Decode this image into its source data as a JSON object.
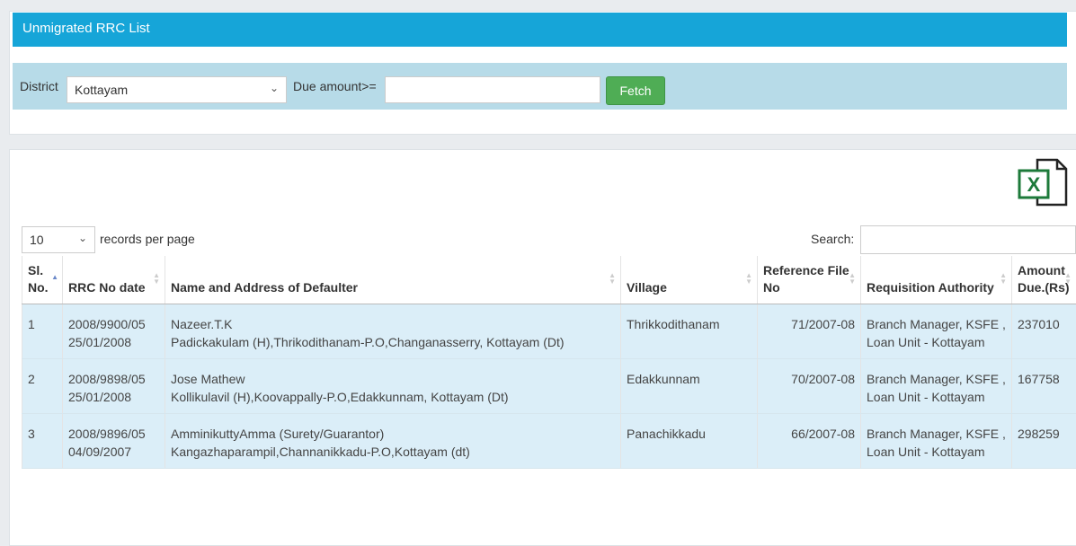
{
  "header": {
    "title": "Unmigrated RRC List"
  },
  "filters": {
    "district_label": "District",
    "district_value": "Kottayam",
    "due_label": "Due amount>=",
    "due_value": "",
    "fetch_label": "Fetch"
  },
  "export": {
    "icon": "excel-icon",
    "letter": "X"
  },
  "controls": {
    "page_length": "10",
    "page_length_suffix": "records per page",
    "search_label": "Search:",
    "search_value": ""
  },
  "table": {
    "headers": [
      "Sl. No.",
      "RRC No date",
      "Name and Address of Defaulter",
      "Village",
      "Reference File No",
      "Requisition Authority",
      "Amount Due.(Rs)"
    ],
    "rows": [
      {
        "sl": "1",
        "rrc_no": "2008/9900/05",
        "rrc_date": "25/01/2008",
        "name": "Nazeer.T.K",
        "address": "Padickakulam (H),Thrikodithanam-P.O,Changanasserry, Kottayam (Dt)",
        "village": "Thrikkodithanam",
        "ref": "71/2007-08",
        "authority": "Branch Manager, KSFE , Loan Unit - Kottayam",
        "amount": "237010"
      },
      {
        "sl": "2",
        "rrc_no": "2008/9898/05",
        "rrc_date": "25/01/2008",
        "name": "Jose Mathew",
        "address": "Kollikulavil (H),Koovappally-P.O,Edakkunnam, Kottayam (Dt)",
        "village": "Edakkunnam",
        "ref": "70/2007-08",
        "authority": "Branch Manager, KSFE , Loan Unit - Kottayam",
        "amount": "167758"
      },
      {
        "sl": "3",
        "rrc_no": "2008/9896/05",
        "rrc_date": "04/09/2007",
        "name": "AmminikuttyAmma (Surety/Guarantor)",
        "address": "Kangazhaparampil,Channanikkadu-P.O,Kottayam (dt)",
        "village": "Panachikkadu",
        "ref": "66/2007-08",
        "authority": "Branch Manager, KSFE , Loan Unit - Kottayam",
        "amount": "298259"
      }
    ]
  },
  "colors": {
    "title_bar": "#16a5d8",
    "filter_bar": "#b7dbe8",
    "fetch_button": "#4fad55",
    "row_bg": "#dbeef8"
  }
}
